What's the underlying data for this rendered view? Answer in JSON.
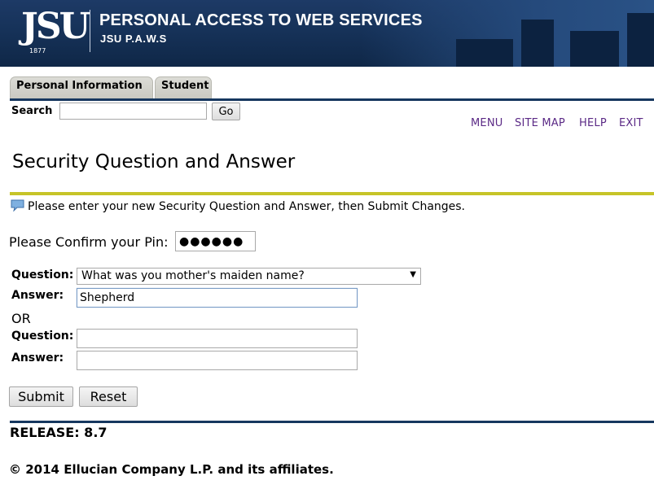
{
  "banner": {
    "logo_text": "JSU",
    "logo_year": "1877",
    "title": "PERSONAL ACCESS TO WEB SERVICES",
    "subtitle": "JSU P.A.W.S"
  },
  "tabs": [
    {
      "label": "Personal Information"
    },
    {
      "label": "Student"
    }
  ],
  "search": {
    "label": "Search",
    "value": "",
    "go_label": "Go"
  },
  "nav_links": [
    {
      "label": "MENU"
    },
    {
      "label": "SITE MAP"
    },
    {
      "label": "HELP"
    },
    {
      "label": "EXIT"
    }
  ],
  "page_title": "Security Question and Answer",
  "info": {
    "icon": "speech-bubble-icon",
    "text": "Please enter your new Security Question and Answer, then Submit Changes."
  },
  "form": {
    "pin_label": "Please Confirm your Pin:",
    "pin_value": "●●●●●●",
    "question1_label": "Question:",
    "question1_selected": "What was you mother's maiden name?",
    "answer1_label": "Answer:",
    "answer1_value": "Shepherd",
    "or_label": "OR",
    "question2_label": "Question:",
    "question2_value": "",
    "answer2_label": "Answer:",
    "answer2_value": "",
    "submit_label": "Submit",
    "reset_label": "Reset"
  },
  "footer": {
    "release": "RELEASE: 8.7",
    "copyright": "© 2014 Ellucian Company L.P. and its affiliates."
  },
  "colors": {
    "banner_bg": "#163259",
    "rule_navy": "#16375f",
    "rule_yellow": "#c6c428",
    "link_purple": "#5b2a86"
  }
}
